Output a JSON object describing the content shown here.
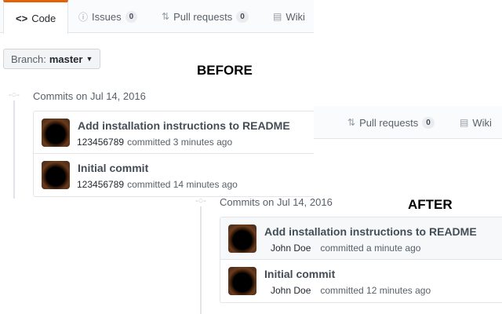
{
  "tabs": [
    {
      "label": "Code",
      "icon": "code-icon"
    },
    {
      "label": "Issues",
      "count": "0",
      "icon": "issue-icon"
    },
    {
      "label": "Pull requests",
      "count": "0",
      "icon": "pull-request-icon"
    },
    {
      "label": "Wiki",
      "icon": "book-icon"
    }
  ],
  "branch": {
    "prefix": "Branch:",
    "name": "master"
  },
  "before": {
    "label": "BEFORE",
    "commits_header": "Commits on Jul 14, 2016",
    "commits": [
      {
        "title": "Add installation instructions to README",
        "author": "123456789",
        "time": "committed 3 minutes ago"
      },
      {
        "title": "Initial commit",
        "author": "123456789",
        "time": "committed 14 minutes ago"
      }
    ]
  },
  "after": {
    "label": "AFTER",
    "commits_header": "Commits on Jul 14, 2016",
    "commits": [
      {
        "title": "Add installation instructions to README",
        "author": "John Doe",
        "time": "committed a minute ago"
      },
      {
        "title": "Initial commit",
        "author": "John Doe",
        "time": "committed 12 minutes ago"
      }
    ]
  }
}
